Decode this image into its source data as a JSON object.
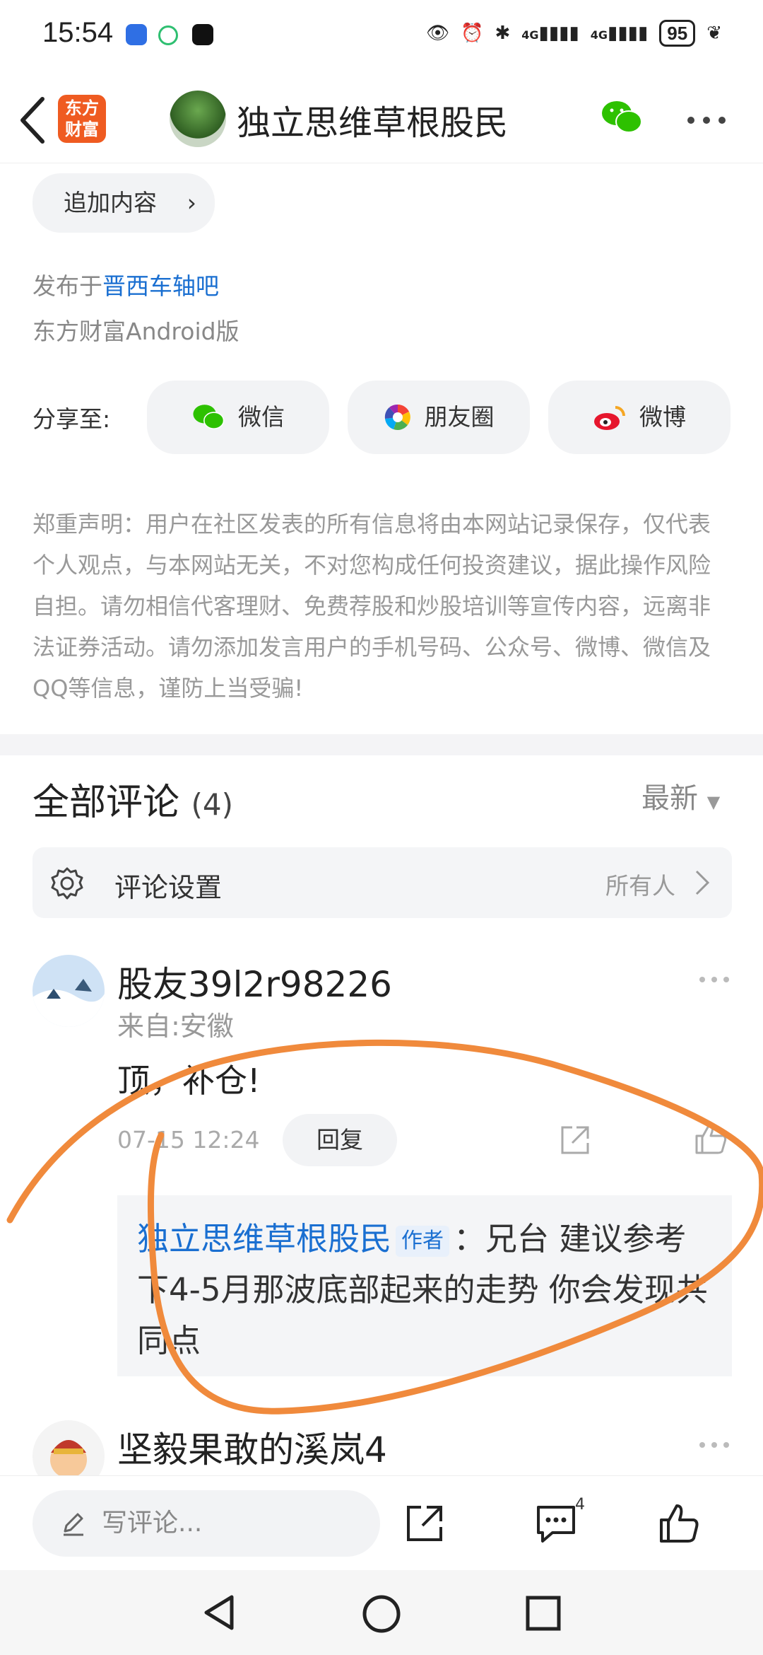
{
  "status": {
    "time": "15:54",
    "battery": "95",
    "net1": "4G",
    "net2": "4G"
  },
  "header": {
    "logo_line1": "东方",
    "logo_line2": "财富",
    "title": "独立思维草根股民"
  },
  "post": {
    "add_content": "追加内容",
    "published_prefix": "发布于",
    "published_bar": "晋西车轴吧",
    "client": "东方财富Android版",
    "share_label": "分享至:",
    "share_buttons": [
      "微信",
      "朋友圈",
      "微博"
    ],
    "notice": "郑重声明：用户在社区发表的所有信息将由本网站记录保存，仅代表个人观点，与本网站无关，不对您构成任何投资建议，据此操作风险自担。请勿相信代客理财、免费荐股和炒股培训等宣传内容，远离非法证券活动。请勿添加发言用户的手机号码、公众号、微博、微信及QQ等信息，谨防上当受骗!"
  },
  "comments": {
    "title": "全部评论",
    "count": "(4)",
    "sort": "最新",
    "settings_label": "评论设置",
    "settings_value": "所有人",
    "items": [
      {
        "user": "股友39l2r98226",
        "from": "来自:安徽",
        "content": "顶，补仓!",
        "time": "07-15 12:24",
        "reply_label": "回复",
        "sub_reply": {
          "author": "独立思维草根股民",
          "badge": "作者",
          "text": "：兄台 建议参考下4-5月那波底部起来的走势 你会发现共同点"
        }
      },
      {
        "user": "坚毅果敢的溪岚4"
      }
    ]
  },
  "bottom": {
    "write_placeholder": "写评论...",
    "comment_count": "4"
  },
  "colors": {
    "accent": "#1a6fd1",
    "brand": "#ef5b21",
    "annotation": "#f08a3c"
  }
}
